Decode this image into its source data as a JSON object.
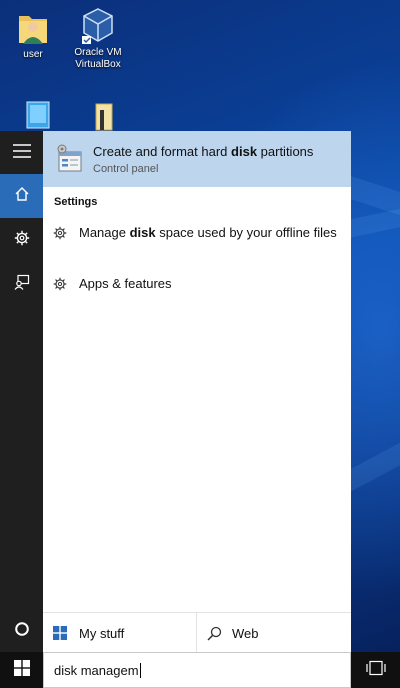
{
  "desktop": {
    "icons": [
      {
        "label": "user",
        "icon": "user-folder-icon"
      },
      {
        "label": "Oracle VM VirtualBox",
        "icon": "virtualbox-icon"
      },
      {
        "label": "",
        "icon": "computer-icon"
      },
      {
        "label": "",
        "icon": "folder-icon"
      }
    ]
  },
  "rail": {
    "items": [
      "hamburger-menu-icon",
      "home-icon",
      "gear-icon",
      "feedback-icon",
      "cortana-icon"
    ]
  },
  "best_match": {
    "title_before": "Create and format hard ",
    "title_bold": "disk",
    "title_after": " partitions",
    "subtitle": "Control panel",
    "icon": "disk-management-icon"
  },
  "settings": {
    "heading": "Settings",
    "items": [
      {
        "before": "Manage ",
        "bold": "disk",
        "after": " space used by your offline files",
        "icon": "gear-icon"
      },
      {
        "text": "Apps & features",
        "icon": "gear-icon"
      }
    ]
  },
  "bottom_tabs": {
    "my_stuff": "My stuff",
    "web": "Web"
  },
  "search": {
    "query": "disk managem"
  },
  "colors": {
    "rail": "#1f1f1f",
    "rail_active": "#2b6cb8",
    "best_match_bg": "#bdd6ee",
    "taskbar": "#101010"
  }
}
